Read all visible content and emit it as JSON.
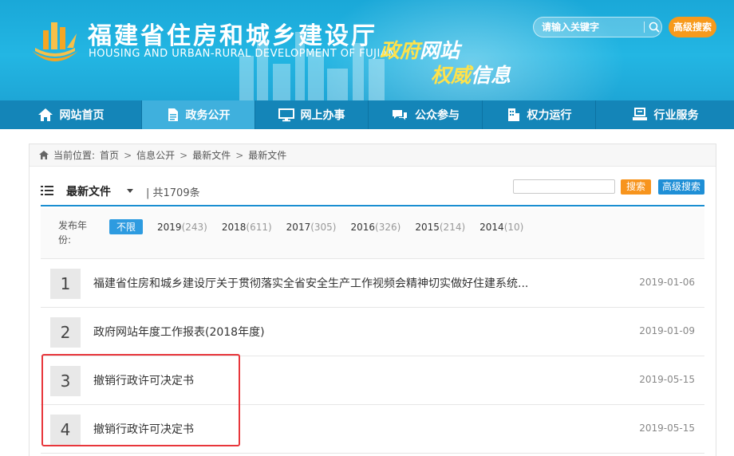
{
  "header": {
    "site_title": "福建省住房和城乡建设厅",
    "site_subtitle": "HOUSING AND URBAN-RURAL DEVELOPMENT OF FUJIAN",
    "slogan_line1_a": "政府",
    "slogan_line1_b": "网站",
    "slogan_line2_a": "权威",
    "slogan_line2_b": "信息",
    "search_placeholder": "请输入关键字",
    "advanced_search_label": "高级搜索",
    "logo_icon": "building-logo-icon"
  },
  "nav": {
    "items": [
      {
        "label": "网站首页",
        "icon": "home-icon",
        "active": false
      },
      {
        "label": "政务公开",
        "icon": "document-icon",
        "active": true
      },
      {
        "label": "网上办事",
        "icon": "monitor-icon",
        "active": false
      },
      {
        "label": "公众参与",
        "icon": "chat-icon",
        "active": false
      },
      {
        "label": "权力运行",
        "icon": "building-icon",
        "active": false
      },
      {
        "label": "行业服务",
        "icon": "service-icon",
        "active": false
      }
    ]
  },
  "breadcrumb": {
    "prefix": "当前位置:",
    "items": [
      "首页",
      "信息公开",
      "最新文件",
      "最新文件"
    ]
  },
  "list": {
    "title": "最新文件",
    "count_text": "| 共1709条",
    "search_label": "搜索",
    "advanced_label": "高级搜索"
  },
  "year_filter": {
    "label": "发布年份:",
    "all_label": "不限",
    "years": [
      {
        "year": "2019",
        "count": "(243)"
      },
      {
        "year": "2018",
        "count": "(611)"
      },
      {
        "year": "2017",
        "count": "(305)"
      },
      {
        "year": "2016",
        "count": "(326)"
      },
      {
        "year": "2015",
        "count": "(214)"
      },
      {
        "year": "2014",
        "count": "(10)"
      }
    ]
  },
  "rows": [
    {
      "num": "1",
      "title": "福建省住房和城乡建设厅关于贯彻落实全省安全生产工作视频会精神切实做好住建系统...",
      "date": "2019-01-06"
    },
    {
      "num": "2",
      "title": "政府网站年度工作报表(2018年度)",
      "date": "2019-01-09"
    },
    {
      "num": "3",
      "title": "撤销行政许可决定书",
      "date": "2019-05-15"
    },
    {
      "num": "4",
      "title": "撤销行政许可决定书",
      "date": "2019-05-15"
    }
  ],
  "colors": {
    "header_blue": "#23b6e3",
    "nav_blue": "#1485b8",
    "accent_orange": "#f7941d",
    "highlight_red": "#e8363b"
  }
}
